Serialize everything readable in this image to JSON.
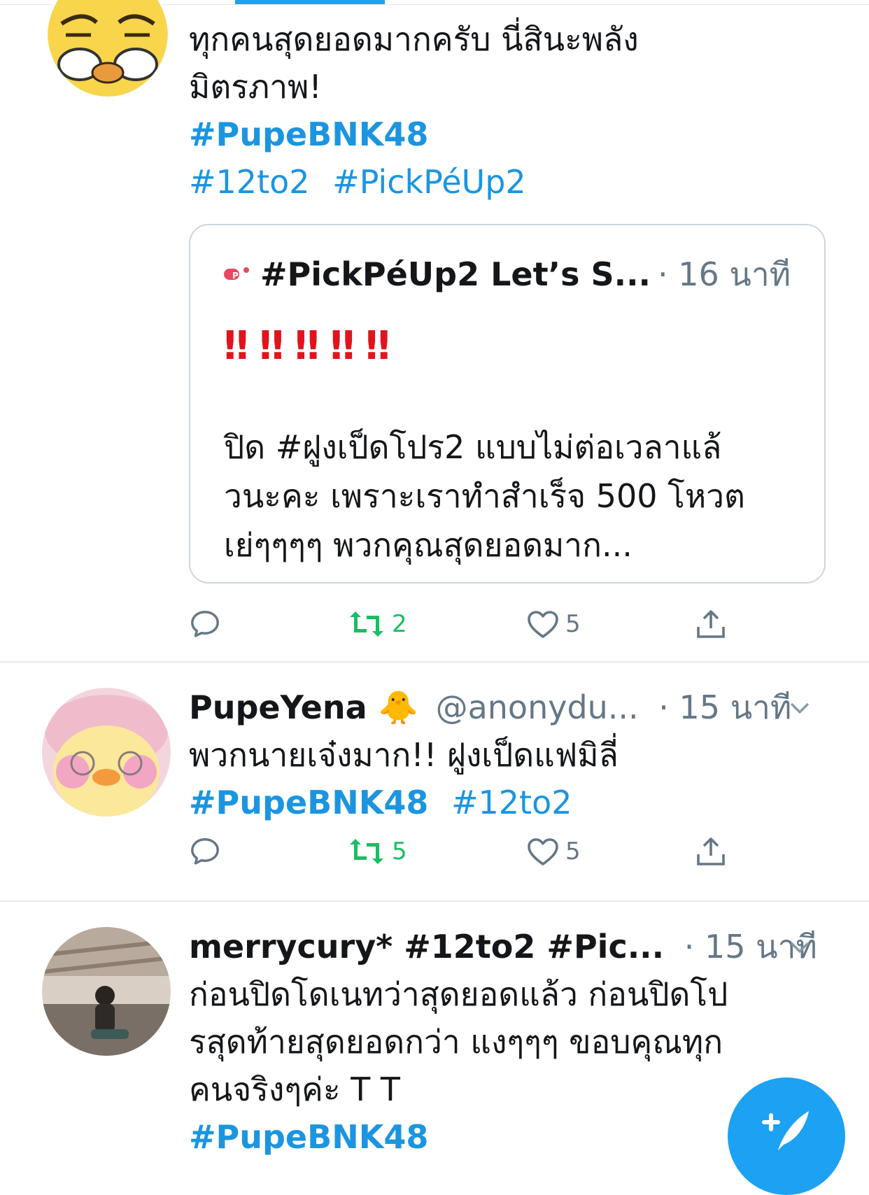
{
  "tweets": [
    {
      "body_lines": [
        "ทุกคนสุดยอดมากครับ นี่สินะพลัง",
        "มิตรภาพ!"
      ],
      "hashtags_line1": [
        "#PupeBNK48"
      ],
      "hashtags_line2": [
        "#12to2",
        "#PickPéUp2"
      ],
      "quote": {
        "name": "#PickPéUp2 Let’s S...",
        "time": "· 16 นาที",
        "bangs": "‼ ‼ ‼ ‼ ‼",
        "body_lines": [
          "ปิด #ฝูงเป็ดโปร2 แบบไม่ต่อเวลาแล้",
          "วนะคะ เพราะเราทำสำเร็จ 500 โหวต",
          "เย่ๆๆๆๆ พวกคุณสุดยอดมาก..."
        ]
      },
      "actions": {
        "reply": "",
        "retweet": "2",
        "like": "5"
      }
    },
    {
      "name": "PupeYena 🐥",
      "handle": "@anonydu...",
      "time": "· 15 นาที",
      "body_lines": [
        "พวกนายเจ๋งมาก!! ฝูงเป็ดแฟมิลี่"
      ],
      "hashtags_line1": [
        "#PupeBNK48",
        "#12to2"
      ],
      "actions": {
        "reply": "",
        "retweet": "5",
        "like": "5"
      }
    },
    {
      "name": "merrycury* #12to2 #Pic...",
      "time": "· 15 นาที",
      "body_lines": [
        "ก่อนปิดโดเนทว่าสุดยอดแล้ว ก่อนปิดโป",
        "รสุดท้ายสุดยอดกว่า แงๆๆๆ ขอบคุณทุก",
        "คนจริงๆค่ะ T T"
      ],
      "hashtags_line1": [
        "#PupeBNK48"
      ]
    }
  ],
  "icons": {
    "reply": "reply-icon",
    "retweet": "retweet-icon",
    "like": "heart-icon",
    "share": "share-icon",
    "more": "chevron-down-icon",
    "compose": "compose-icon"
  },
  "colors": {
    "link": "#1b95e0",
    "retweet": "#17bf63",
    "muted": "#657786",
    "quote_bang": "#e0141c",
    "fab": "#1da1f2"
  }
}
